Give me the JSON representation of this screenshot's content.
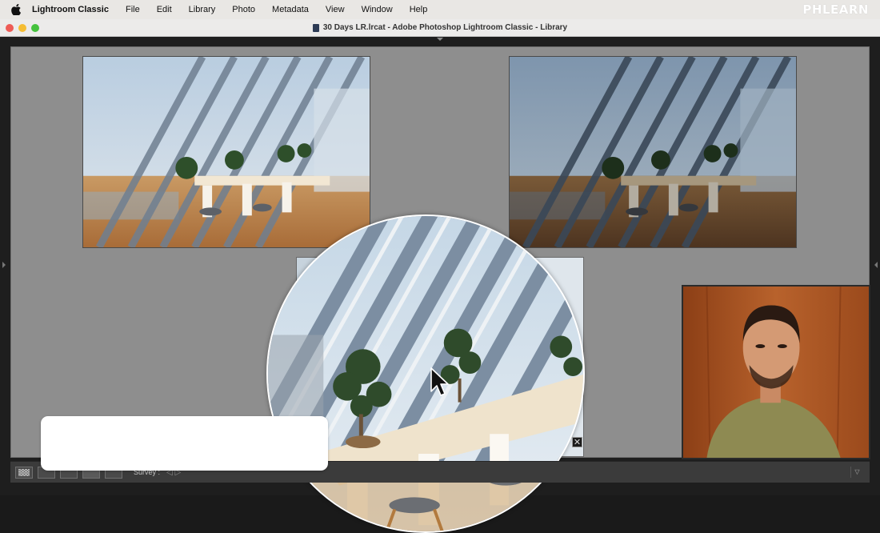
{
  "menubar": {
    "app_name": "Lightroom Classic",
    "items": [
      "File",
      "Edit",
      "Library",
      "Photo",
      "Metadata",
      "View",
      "Window",
      "Help"
    ],
    "brand_watermark": "PHLEARN"
  },
  "window": {
    "title": "30 Days LR.lrcat - Adobe Photoshop Lightroom Classic - Library"
  },
  "library": {
    "view_mode": "Survey",
    "photos": [
      {
        "name": "office-photo-bright",
        "state": "brighter exposure"
      },
      {
        "name": "office-photo-dark",
        "state": "darker exposure"
      },
      {
        "name": "office-photo-third",
        "state": "partially hidden by magnifier"
      }
    ]
  },
  "toolbar": {
    "view_label": "Survey :",
    "icons": [
      "grid-icon",
      "loupe-icon",
      "compare-icon",
      "survey-icon",
      "people-icon"
    ],
    "nav_arrows": "◁ ▷",
    "dropdown": "▽"
  },
  "magnifier": {
    "close_label": "✕"
  },
  "colors": {
    "survey_bg": "#8e8e8e",
    "menubar_bg": "#e9e7e4",
    "window_bg": "#1e1e1e"
  }
}
